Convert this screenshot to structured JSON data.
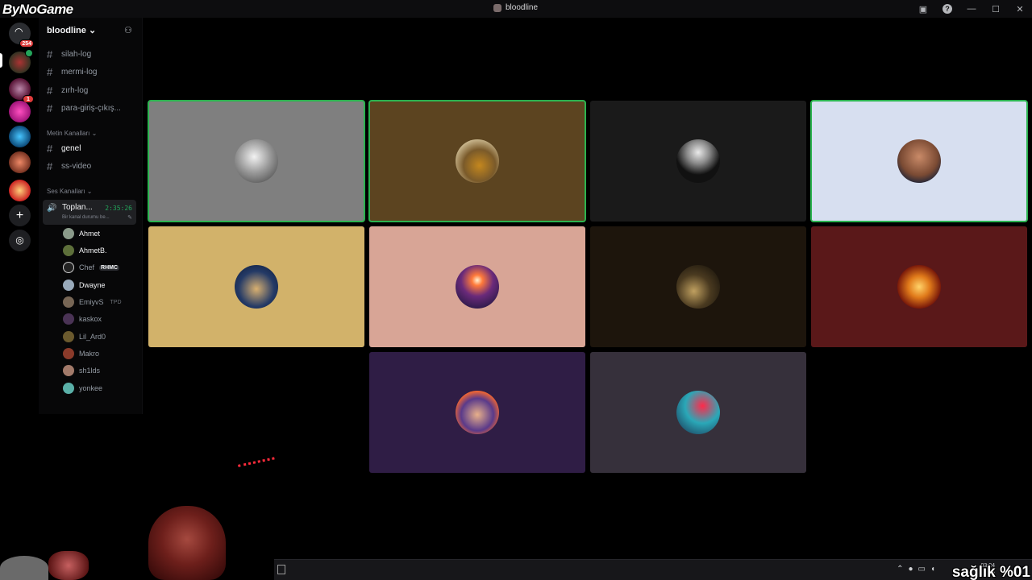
{
  "overlay": {
    "watermark": "ByNoGame",
    "health_text": "sağlık %01"
  },
  "window": {
    "title": "bloodline",
    "minimize": "—",
    "maximize": "☐",
    "close": "✕",
    "help": "?"
  },
  "rail": {
    "dm_badge": "254",
    "badge_1": "1"
  },
  "server": {
    "name": "bloodline",
    "chevron": "⌄",
    "text_channels_top": [
      {
        "name": "silah-log"
      },
      {
        "name": "mermi-log"
      },
      {
        "name": "zırh-log"
      },
      {
        "name": "para-giriş-çıkış..."
      }
    ],
    "cat_text": "Metin Kanalları ⌄",
    "text_channels": [
      {
        "name": "genel"
      },
      {
        "name": "ss-video"
      }
    ],
    "cat_voice": "Ses Kanalları ⌄",
    "voice": {
      "name": "Toplan...",
      "timer": "2:35:26",
      "status": "Bir kanal durumu be..."
    },
    "members": [
      {
        "name": "Ahmet",
        "tag": ""
      },
      {
        "name": "AhmetB.",
        "tag": ""
      },
      {
        "name": "Chef",
        "tag": "RHMC"
      },
      {
        "name": "Dwayne",
        "tag": ""
      },
      {
        "name": "EmiyvS",
        "tag": "TPD"
      },
      {
        "name": "kaskox",
        "tag": ""
      },
      {
        "name": "Lil_Ard0",
        "tag": ""
      },
      {
        "name": "Makro",
        "tag": ""
      },
      {
        "name": "sh1lds",
        "tag": ""
      },
      {
        "name": "yonkee",
        "tag": ""
      }
    ]
  },
  "tiles": [
    {
      "bg": "#7f7f7f",
      "speaking": true
    },
    {
      "bg": "#5c4420",
      "speaking": true
    },
    {
      "bg": "#1a1a1a",
      "speaking": false
    },
    {
      "bg": "#d7dff0",
      "speaking": true
    },
    {
      "bg": "#d2b26a",
      "speaking": false
    },
    {
      "bg": "#d8a596",
      "speaking": false
    },
    {
      "bg": "#1d150c",
      "speaking": false
    },
    {
      "bg": "#5a1819",
      "speaking": false
    },
    {
      "bg": "#2f1d45",
      "speaking": false
    },
    {
      "bg": "#36303b",
      "speaking": false
    }
  ],
  "taskbar": {
    "time": "03:24",
    "date": "...26"
  },
  "colors": {
    "speaking": "#2bb34f",
    "accent_green": "#23a55a",
    "badge": "#e03b3b"
  }
}
